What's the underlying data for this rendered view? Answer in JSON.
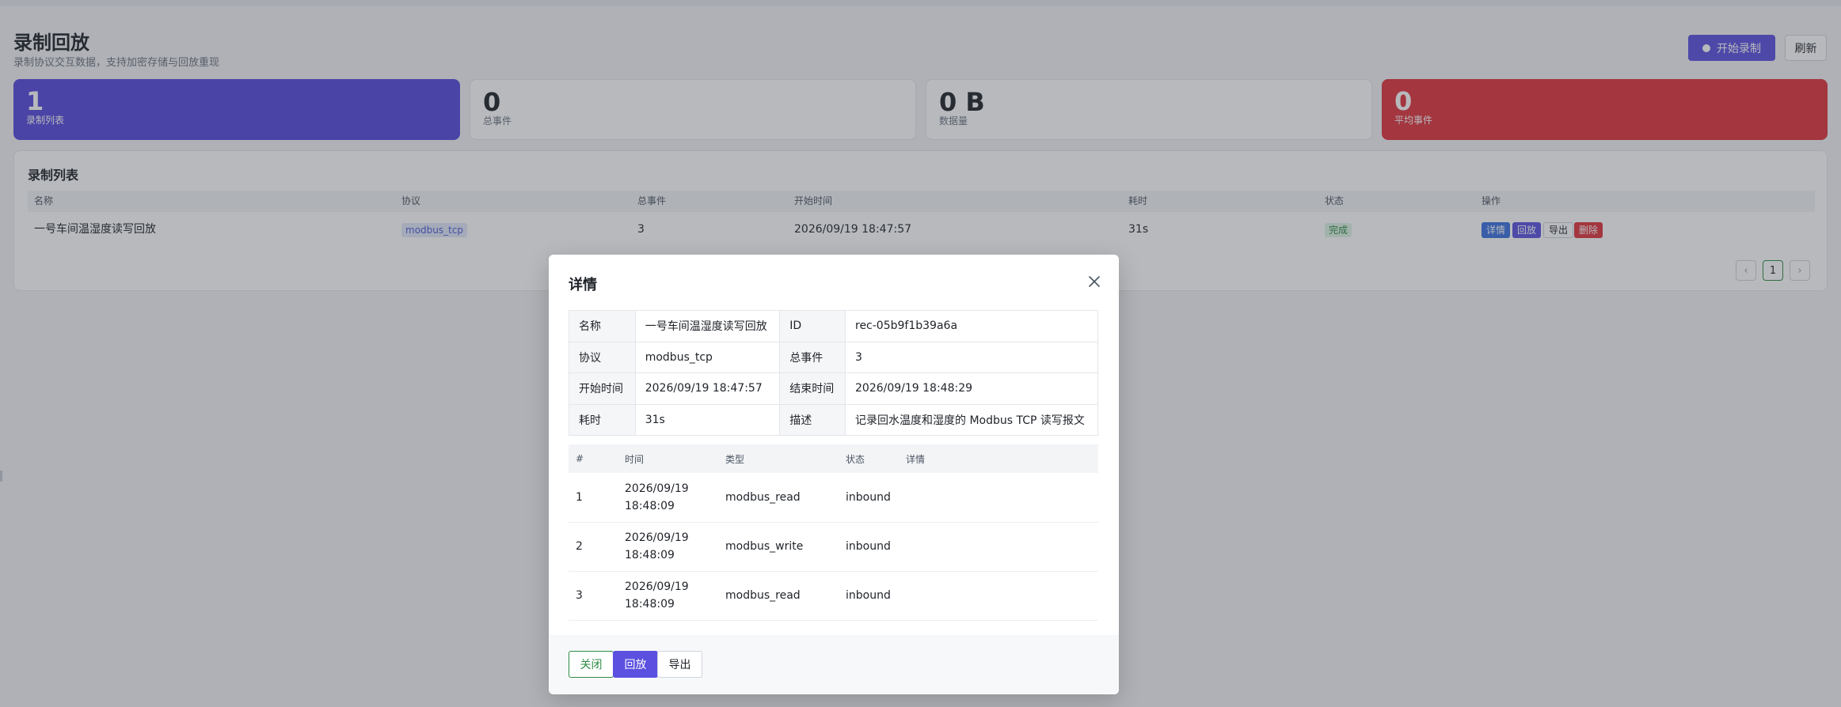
{
  "page": {
    "title": "录制回放",
    "subtitle": "录制协议交互数据，支持加密存储与回放重现",
    "record_button": "开始录制",
    "refresh_button": "刷新"
  },
  "stats": [
    {
      "value": "1",
      "label": "录制列表",
      "color": "#5548de"
    },
    {
      "value": "0",
      "label": "总事件"
    },
    {
      "value": "0 B",
      "label": "数据量"
    },
    {
      "value": "0",
      "label": "平均事件",
      "color": "#e0333c"
    }
  ],
  "list": {
    "title": "录制列表",
    "columns": [
      "名称",
      "协议",
      "总事件",
      "开始时间",
      "耗时",
      "状态",
      "操作"
    ],
    "rows": [
      {
        "name": "一号车间温湿度读写回放",
        "protocol": "modbus_tcp",
        "total_events": "3",
        "start_time": "2026/09/19 18:47:57",
        "duration": "31s",
        "status": "完成",
        "actions": {
          "detail": "详情",
          "replay": "回放",
          "export": "导出",
          "delete": "删除"
        }
      }
    ],
    "pagination": {
      "current": "1",
      "prev": "‹",
      "next": "›"
    }
  },
  "modal": {
    "title": "详情",
    "info": {
      "name_label": "名称",
      "name_value": "一号车间温湿度读写回放",
      "id_label": "ID",
      "id_value": "rec-05b9f1b39a6a",
      "protocol_label": "协议",
      "protocol_value": "modbus_tcp",
      "events_label": "总事件",
      "events_value": "3",
      "start_label": "开始时间",
      "start_value": "2026/09/19 18:47:57",
      "end_label": "结束时间",
      "end_value": "2026/09/19 18:48:29",
      "duration_label": "耗时",
      "duration_value": "31s",
      "desc_label": "描述",
      "desc_value": "记录回水温度和湿度的 Modbus TCP 读写报文"
    },
    "events": {
      "columns": [
        "#",
        "时间",
        "类型",
        "状态",
        "详情"
      ],
      "rows": [
        {
          "idx": "1",
          "date": "2026/09/19",
          "time": "18:48:09",
          "type": "modbus_read",
          "status": "inbound",
          "detail": ""
        },
        {
          "idx": "2",
          "date": "2026/09/19",
          "time": "18:48:09",
          "type": "modbus_write",
          "status": "inbound",
          "detail": ""
        },
        {
          "idx": "3",
          "date": "2026/09/19",
          "time": "18:48:09",
          "type": "modbus_read",
          "status": "inbound",
          "detail": ""
        }
      ]
    },
    "footer": {
      "close": "关闭",
      "replay": "回放",
      "export": "导出"
    }
  }
}
